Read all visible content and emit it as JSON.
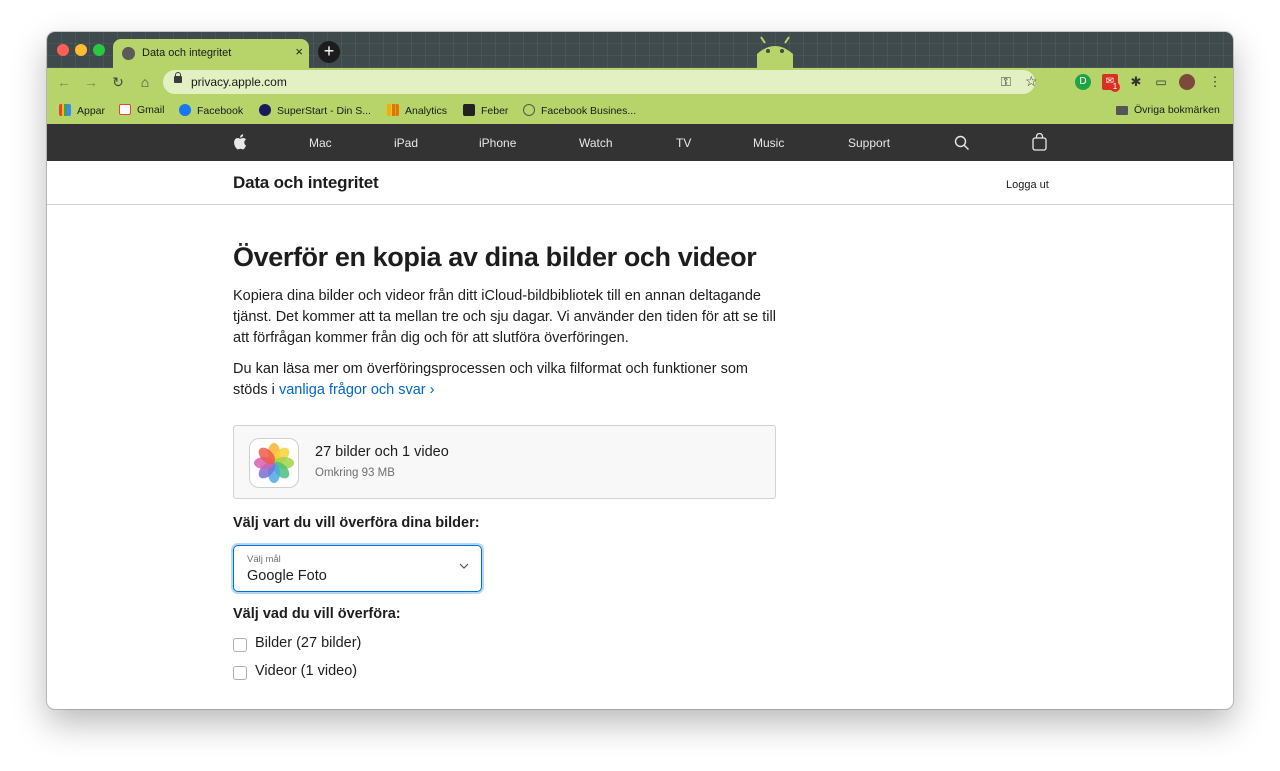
{
  "browser": {
    "tab_title": "Data och integritet",
    "url": "privacy.apple.com",
    "bookmarks": [
      {
        "label": "Appar",
        "icon": "apps-grid-icon"
      },
      {
        "label": "Gmail",
        "icon": "gmail-icon"
      },
      {
        "label": "Facebook",
        "icon": "facebook-icon"
      },
      {
        "label": "SuperStart - Din S...",
        "icon": "superstart-icon"
      },
      {
        "label": "Analytics",
        "icon": "analytics-icon"
      },
      {
        "label": "Feber",
        "icon": "feber-icon"
      },
      {
        "label": "Facebook Busines...",
        "icon": "facebook-business-icon"
      }
    ],
    "other_bookmarks": "Övriga bokmärken",
    "mail_badge": "1"
  },
  "apple_nav": {
    "items": [
      "Mac",
      "iPad",
      "iPhone",
      "Watch",
      "TV",
      "Music",
      "Support"
    ]
  },
  "subheader": {
    "title": "Data och integritet",
    "logout": "Logga ut"
  },
  "main": {
    "heading": "Överför en kopia av dina bilder och videor",
    "paragraph1": "Kopiera dina bilder och videor från ditt iCloud-bildbibliotek till en annan deltagande tjänst. Det kommer att ta mellan tre och sju dagar. Vi använder den tiden för att se till att förfrågan kommer från dig och för att slutföra överföringen.",
    "paragraph2_prefix": "Du kan läsa mer om överföringsprocessen och vilka filformat och funktioner som stöds i",
    "paragraph2_link": "vanliga frågor och svar ›",
    "library": {
      "title": "27 bilder och 1 video",
      "size": "Omkring 93 MB"
    },
    "destination_label": "Välj vart du vill överföra dina bilder:",
    "select": {
      "small_label": "Välj mål",
      "value": "Google Foto"
    },
    "what_label": "Välj vad du vill överföra:",
    "options": [
      {
        "label": "Bilder (27 bilder)",
        "checked": false
      },
      {
        "label": "Videor (1 video)",
        "checked": false
      }
    ]
  },
  "colors": {
    "chrome_theme": "#b6d46a",
    "apple_nav_bg": "#333333",
    "link": "#0066cc",
    "focus_ring": "#0071e3"
  }
}
